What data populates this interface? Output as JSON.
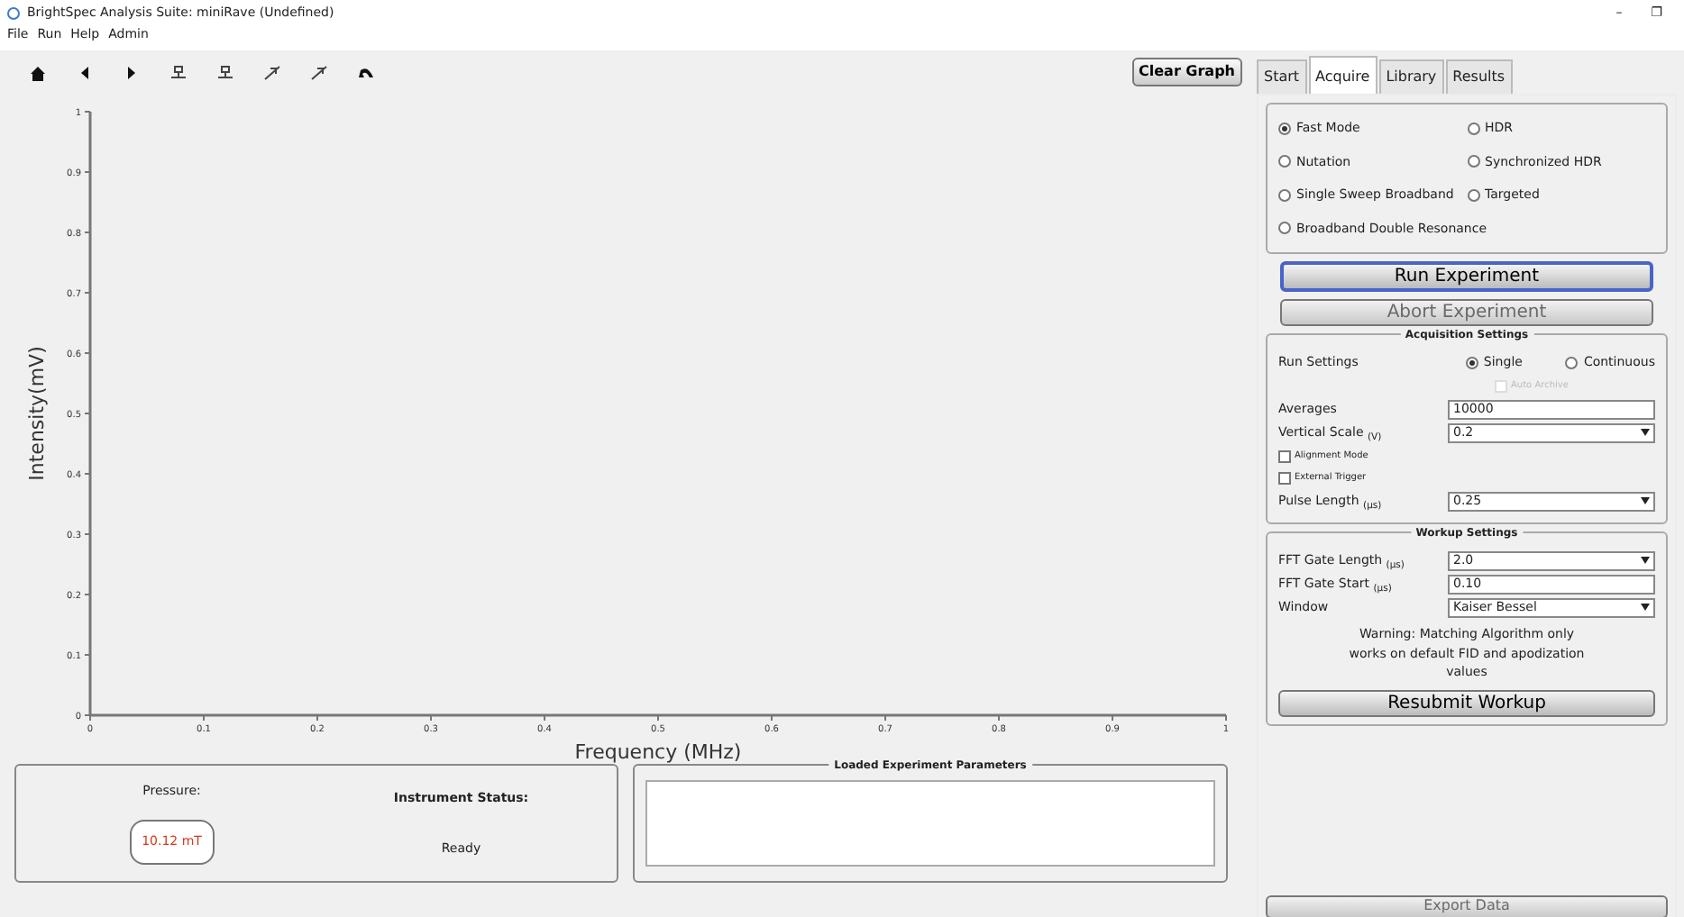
{
  "window": {
    "title": "BrightSpec Analysis Suite: miniRave (Undefined)",
    "controls": [
      "–",
      "❐"
    ]
  },
  "menu": [
    "File",
    "Run",
    "Help",
    "Admin"
  ],
  "toolbar": {
    "clear_button": "Clear Graph"
  },
  "chart": {
    "chart_data": {
      "type": "line",
      "xlabel": "Frequency (MHz)",
      "ylabel": "Intensity(mV)",
      "xlim": [
        0,
        1
      ],
      "ylim": [
        0,
        1
      ],
      "xticks": [
        {
          "value": 0,
          "label": "0"
        },
        {
          "value": 0.1,
          "label": "0.1"
        },
        {
          "value": 0.2,
          "label": "0.2"
        },
        {
          "value": 0.3,
          "label": "0.3"
        },
        {
          "value": 0.4,
          "label": "0.4"
        },
        {
          "value": 0.5,
          "label": "0.5"
        },
        {
          "value": 0.6,
          "label": "0.6"
        },
        {
          "value": 0.7,
          "label": "0.7"
        },
        {
          "value": 0.8,
          "label": "0.8"
        },
        {
          "value": 0.9,
          "label": "0.9"
        },
        {
          "value": 1,
          "label": "1"
        }
      ],
      "yticks": [
        {
          "value": 0,
          "label": "0"
        },
        {
          "value": 0.1,
          "label": "0.1"
        },
        {
          "value": 0.2,
          "label": "0.2"
        },
        {
          "value": 0.3,
          "label": "0.3"
        },
        {
          "value": 0.4,
          "label": "0.4"
        },
        {
          "value": 0.5,
          "label": "0.5"
        },
        {
          "value": 0.6,
          "label": "0.6"
        },
        {
          "value": 0.7,
          "label": "0.7"
        },
        {
          "value": 0.8,
          "label": "0.8"
        },
        {
          "value": 0.9,
          "label": "0.9"
        },
        {
          "value": 1,
          "label": "1"
        }
      ]
    }
  },
  "status_panel": {
    "pressure_label": "Pressure:",
    "pressure_value": "10.12 mT",
    "status_label": "Instrument Status:",
    "status_value": "Ready"
  },
  "parameters_panel": {
    "title": "Loaded Experiment Parameters"
  },
  "tabs": [
    {
      "label": "Start",
      "selected": false
    },
    {
      "label": "Acquire",
      "selected": true
    },
    {
      "label": "Library",
      "selected": false
    },
    {
      "label": "Results",
      "selected": false
    }
  ],
  "modes": [
    {
      "label": "Fast Mode",
      "selected": true
    },
    {
      "label": "HDR",
      "selected": false
    },
    {
      "label": "Nutation",
      "selected": false
    },
    {
      "label": "Synchronized HDR",
      "selected": false
    },
    {
      "label": "Single Sweep Broadband",
      "selected": false
    },
    {
      "label": "Targeted",
      "selected": false
    },
    {
      "label": "Broadband Double Resonance",
      "selected": false
    }
  ],
  "run_button": {
    "label": "Run Experiment",
    "disabled": false
  },
  "abort_button": {
    "label": "Abort Experiment",
    "disabled": true
  },
  "acquisition": {
    "title": "Acquisition Settings",
    "run_settings_label": "Run Settings",
    "run_options": [
      {
        "label": "Single",
        "selected": true
      },
      {
        "label": "Continuous",
        "selected": false
      }
    ],
    "auto_archive": {
      "label": "Auto Archive",
      "checked": false,
      "disabled": true
    },
    "fields": [
      {
        "kind": "text",
        "label": "Averages",
        "value": "10000"
      },
      {
        "kind": "select",
        "label": "Vertical Scale $_{(V)}$",
        "value": "0.2"
      }
    ],
    "checkboxes": [
      {
        "label": "Alignment Mode",
        "checked": false
      },
      {
        "label": "External Trigger",
        "checked": false
      }
    ],
    "fields2": [
      {
        "kind": "select",
        "label": "Pulse Length $_{(µs)}$",
        "value": "0.25"
      }
    ]
  },
  "workup": {
    "title": "Workup Settings",
    "fields": [
      {
        "kind": "select",
        "label": "FFT Gate Length $_{(µs)}$",
        "value": "2.0"
      },
      {
        "kind": "text",
        "label": "FFT Gate Start $_{(µs)}$",
        "value": "0.10"
      },
      {
        "kind": "select",
        "label": "Window",
        "value": "Kaiser Bessel"
      }
    ],
    "warning": "Warning: Matching Algorithm only works on default FID and apodization values",
    "button": "Resubmit Workup"
  },
  "export_button": {
    "label": "Export Data",
    "disabled": true
  }
}
